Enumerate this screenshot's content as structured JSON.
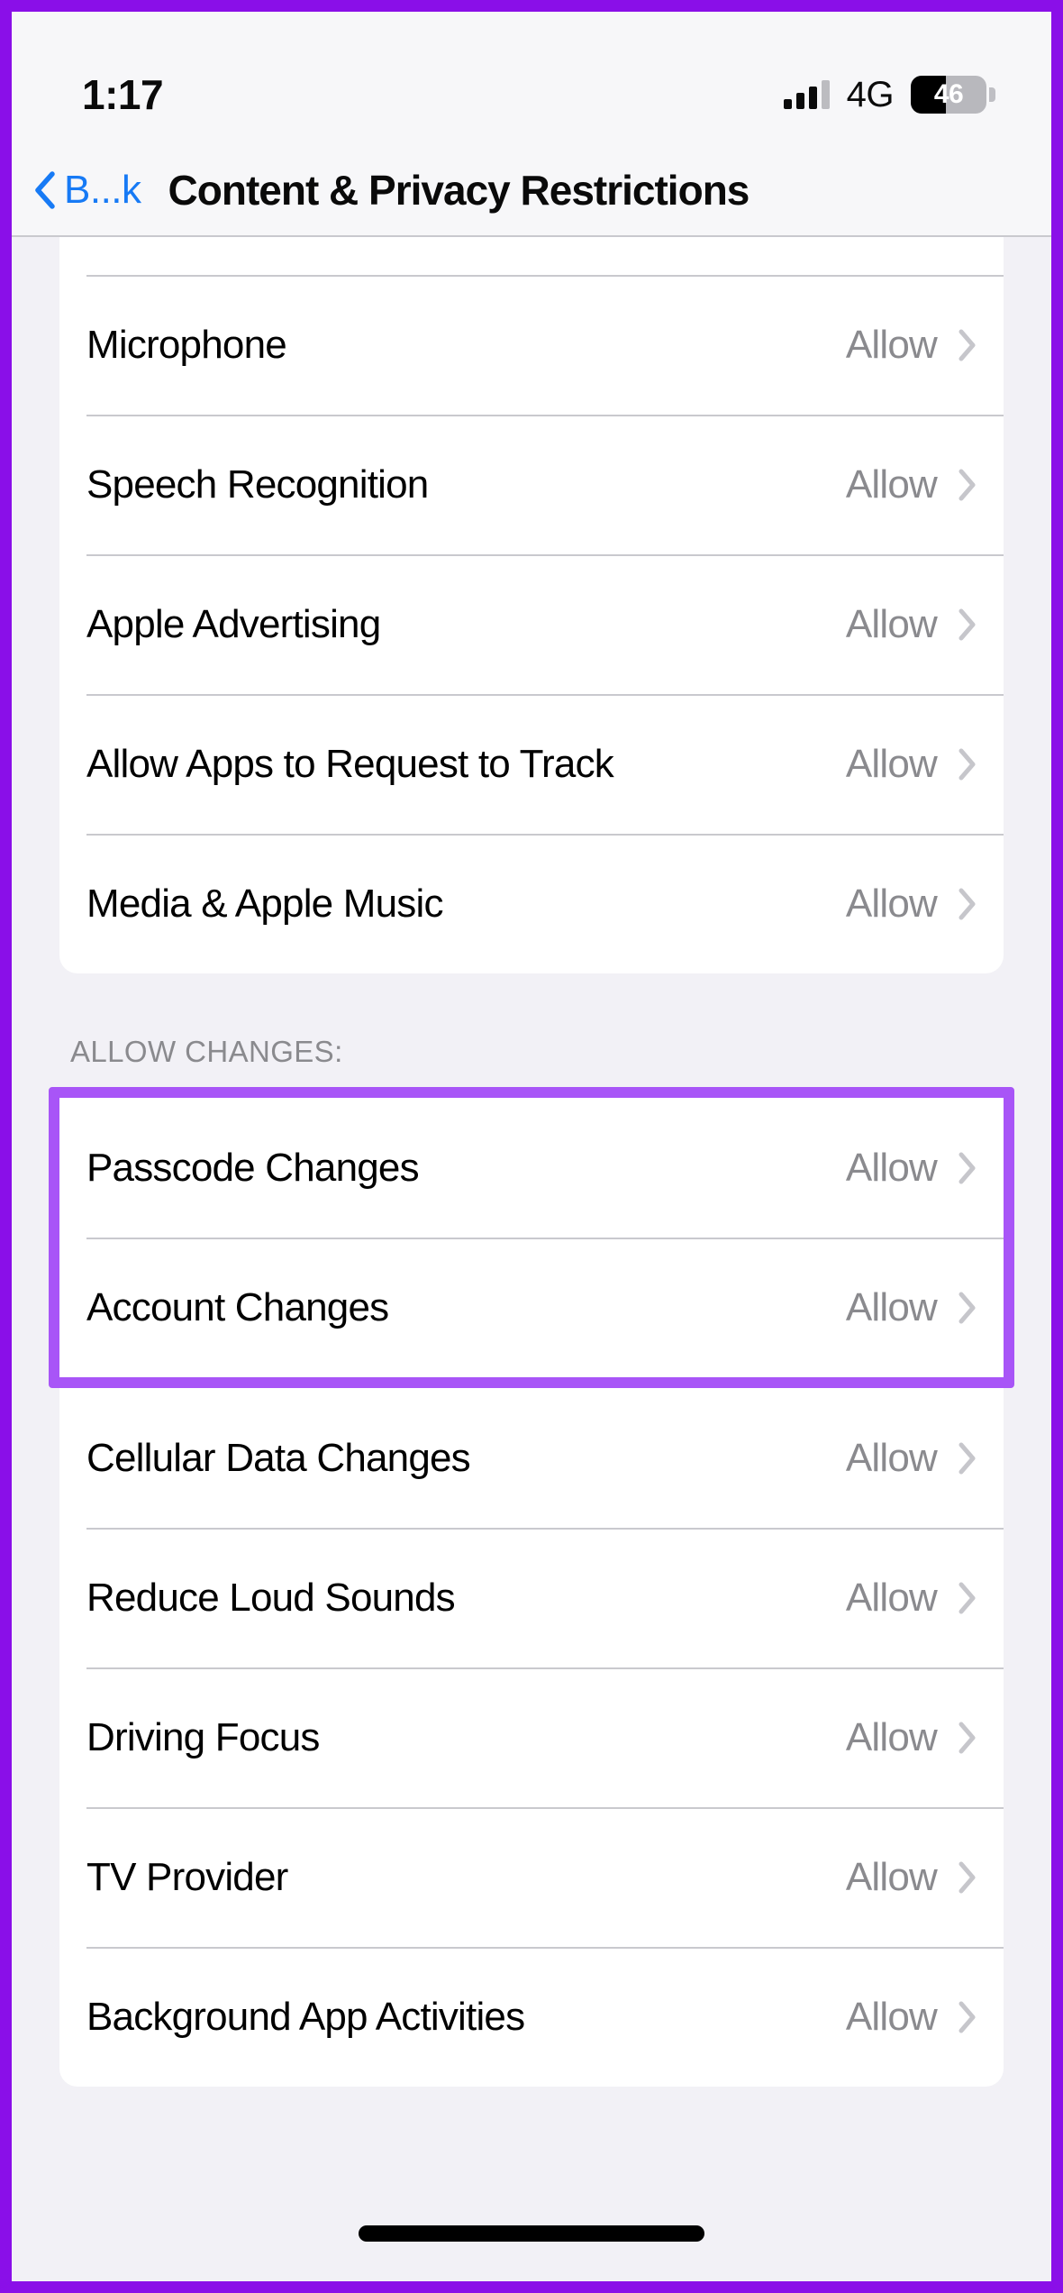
{
  "status_bar": {
    "time": "1:17",
    "network": "4G",
    "battery_percent": "46",
    "battery_level": 46,
    "signal_bars_filled": 3,
    "signal_bars_total": 4
  },
  "nav_bar": {
    "back_label": "B...k",
    "title": "Content & Privacy Restrictions"
  },
  "colors": {
    "annotation_outer": "#8A0FE8",
    "annotation_highlight": "#A855F7",
    "accent_blue": "#177AF5",
    "value_gray": "#8A8A8E",
    "chevron_gray": "#C6C6CB",
    "page_background": "#F2F1F6",
    "card_background": "#FFFFFF"
  },
  "sections": [
    {
      "header": "",
      "rows": [
        {
          "label": "Microphone",
          "value": "Allow"
        },
        {
          "label": "Speech Recognition",
          "value": "Allow"
        },
        {
          "label": "Apple Advertising",
          "value": "Allow"
        },
        {
          "label": "Allow Apps to Request to Track",
          "value": "Allow"
        },
        {
          "label": "Media & Apple Music",
          "value": "Allow"
        }
      ]
    },
    {
      "header": "ALLOW CHANGES:",
      "highlighted_rows": [
        {
          "label": "Passcode Changes",
          "value": "Allow"
        },
        {
          "label": "Account Changes",
          "value": "Allow"
        }
      ],
      "rows": [
        {
          "label": "Cellular Data Changes",
          "value": "Allow"
        },
        {
          "label": "Reduce Loud Sounds",
          "value": "Allow"
        },
        {
          "label": "Driving Focus",
          "value": "Allow"
        },
        {
          "label": "TV Provider",
          "value": "Allow"
        },
        {
          "label": "Background App Activities",
          "value": "Allow"
        }
      ]
    }
  ]
}
